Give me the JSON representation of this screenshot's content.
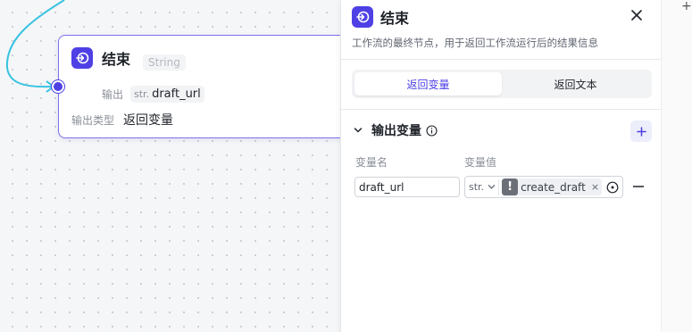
{
  "canvas_node": {
    "title": "结束",
    "hint": "String",
    "output_label": "输出",
    "output_var_type": "str.",
    "output_var_name": "draft_url",
    "output_type_label": "输出类型",
    "output_type_value": "返回变量"
  },
  "panel": {
    "title": "结束",
    "description": "工作流的最终节点，用于返回工作流运行后的结果信息",
    "tabs": [
      {
        "label": "返回变量",
        "active": true
      },
      {
        "label": "返回文本",
        "active": false
      }
    ],
    "section_title": "输出变量",
    "col_name": "变量名",
    "col_value": "变量值",
    "row": {
      "name": "draft_url",
      "type": "str.",
      "reference": "create_draft · ("
    }
  },
  "colors": {
    "brand": "#4e40e5",
    "edge": "#36c3e0"
  },
  "icons": {
    "node": "end-node-icon",
    "close": "close-icon",
    "info": "info-icon",
    "add": "plus-icon",
    "chevron": "chevron-down-icon",
    "warn": "exclamation-icon",
    "target": "target-icon",
    "remove": "minus-icon"
  }
}
